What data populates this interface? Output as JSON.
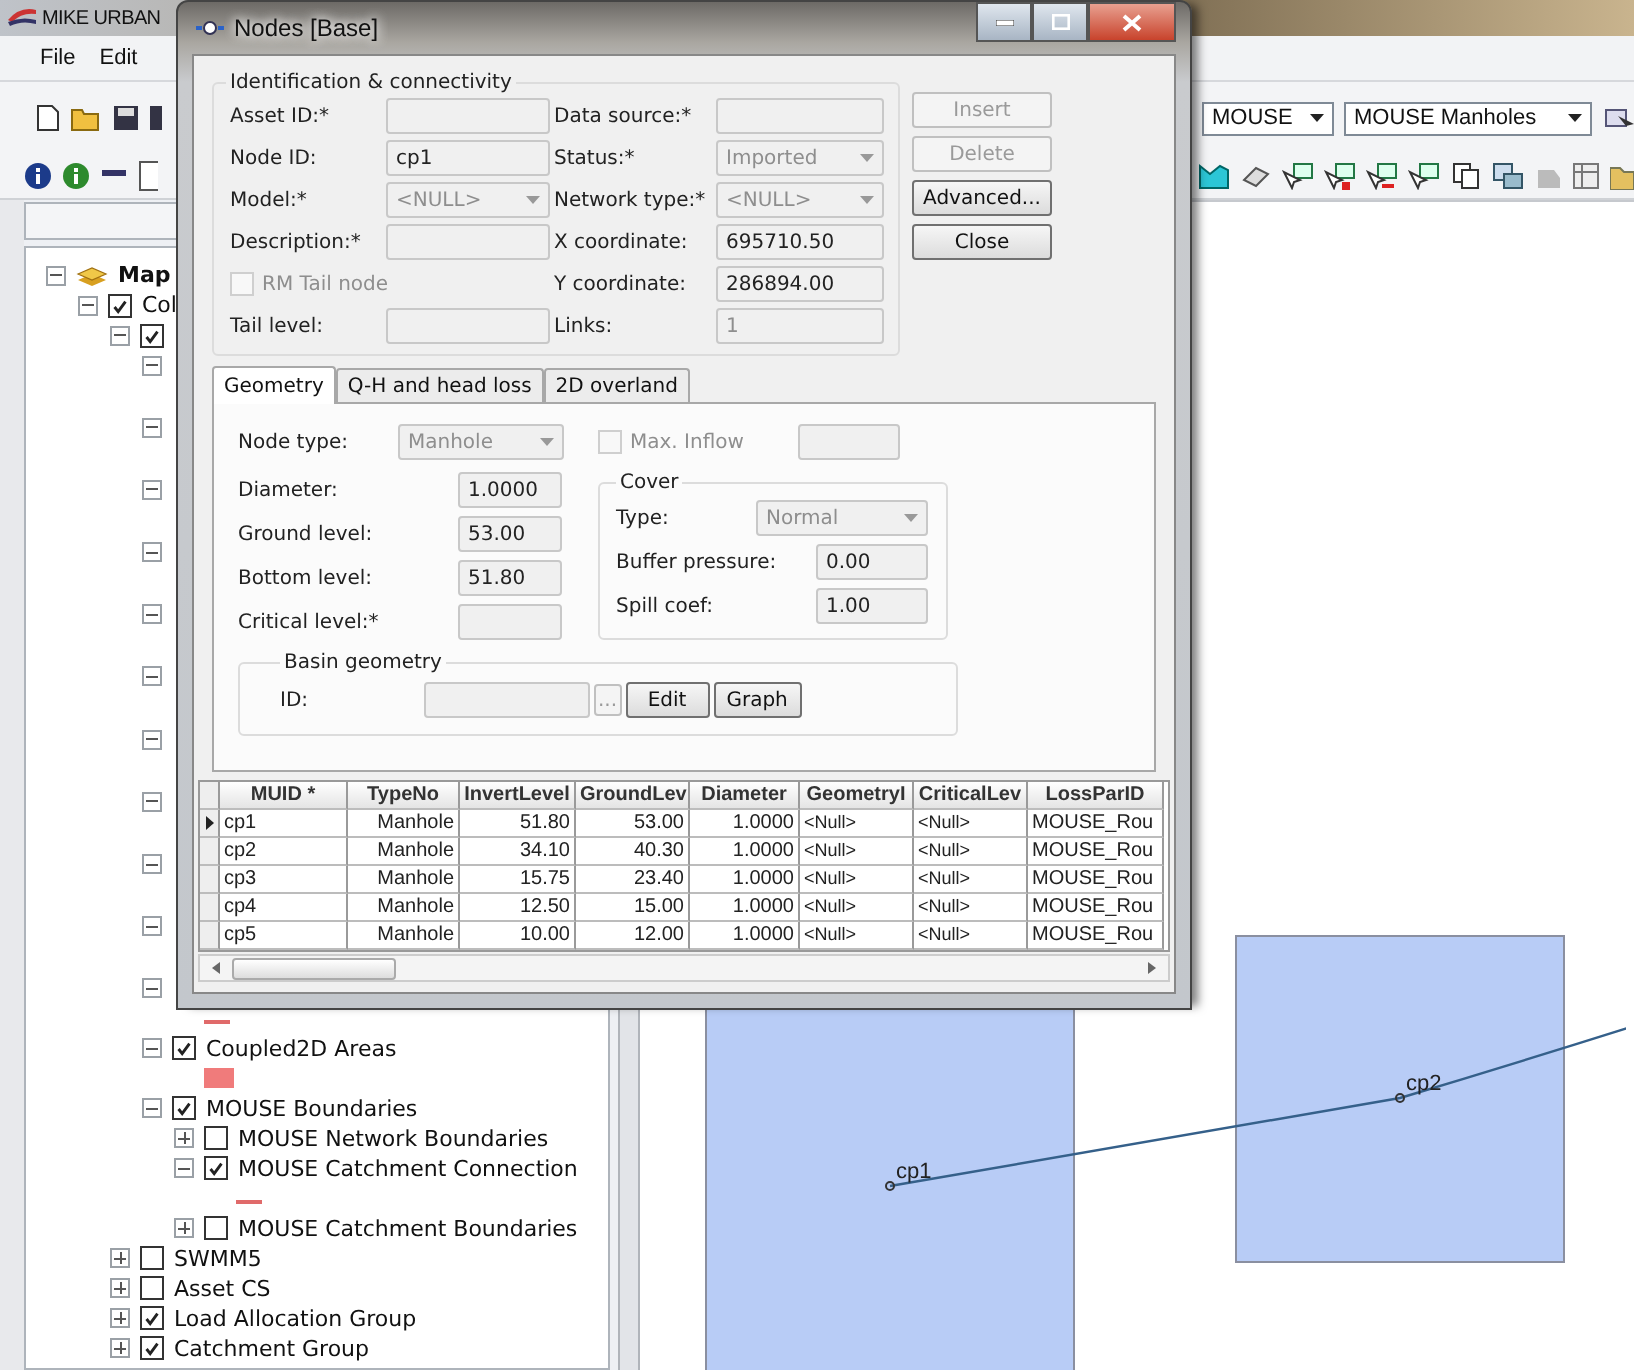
{
  "main_window": {
    "title": "MIKE URBAN",
    "menu": [
      "File",
      "Edit"
    ],
    "toolbar_dropdowns": [
      {
        "value": "MOUSE"
      },
      {
        "value": "MOUSE Manholes"
      }
    ]
  },
  "layers": [
    {
      "label": "Map",
      "expanded": true,
      "children": [
        {
          "label": "Col",
          "checked": true,
          "expanded": true,
          "children": [
            {
              "checked": true,
              "expanded": true,
              "children": [
                {
                  "expanded": true
                },
                {
                  "expanded": true
                },
                {
                  "expanded": true
                },
                {
                  "expanded": true
                },
                {
                  "expanded": true
                },
                {
                  "expanded": true
                },
                {
                  "expanded": true
                },
                {
                  "expanded": true
                },
                {
                  "expanded": true
                },
                {
                  "expanded": true
                },
                {
                  "expanded": true,
                  "legend": {
                    "kind": "line",
                    "color": "#e06a6a"
                  }
                },
                {
                  "label": "Coupled2D Areas",
                  "checked": true,
                  "expanded": true,
                  "legend": {
                    "kind": "fill",
                    "color": "#f07b7b"
                  }
                },
                {
                  "label": "MOUSE Boundaries",
                  "checked": true,
                  "expanded": true,
                  "children": [
                    {
                      "label": "MOUSE Network Boundaries",
                      "checked": false,
                      "expanded": false
                    },
                    {
                      "label": "MOUSE Catchment Connection",
                      "checked": true,
                      "expanded": true,
                      "legend": {
                        "kind": "line",
                        "color": "#e06a6a"
                      }
                    },
                    {
                      "label": "MOUSE Catchment Boundaries",
                      "checked": false,
                      "expanded": false
                    }
                  ]
                }
              ]
            },
            {
              "label": "SWMM5",
              "checked": false,
              "expanded": false
            },
            {
              "label": "Asset CS",
              "checked": false,
              "expanded": false
            },
            {
              "label": "Load Allocation Group",
              "checked": true,
              "expanded": false
            },
            {
              "label": "Catchment Group",
              "checked": true,
              "expanded": false
            }
          ]
        }
      ]
    }
  ],
  "map": {
    "nodes": [
      {
        "label": "cp1"
      },
      {
        "label": "cp2"
      }
    ]
  },
  "dialog": {
    "title": "Nodes [Base]",
    "identification": {
      "title": "Identification & connectivity",
      "fields": [
        {
          "label": "Asset ID:*",
          "kind": "text"
        },
        {
          "label": "Data source:*",
          "kind": "text"
        },
        {
          "label": "Node ID:",
          "kind": "text",
          "value": "cp1"
        },
        {
          "label": "Status:*",
          "kind": "dropdown",
          "value": "Imported",
          "disabled": true
        },
        {
          "label": "Model:*",
          "kind": "dropdown",
          "value": "<NULL>",
          "disabled": true
        },
        {
          "label": "Network type:*",
          "kind": "dropdown",
          "value": "<NULL>",
          "disabled": true
        },
        {
          "label": "Description:*",
          "kind": "text"
        },
        {
          "label": "X coordinate:",
          "kind": "text",
          "value": "695710.50"
        },
        {
          "label": "RM Tail node",
          "kind": "checkbox",
          "checked": false,
          "disabled": true
        },
        {
          "label": "Y coordinate:",
          "kind": "text",
          "value": "286894.00"
        },
        {
          "label": "Tail level:",
          "kind": "text"
        },
        {
          "label": "Links:",
          "kind": "text",
          "value": "1",
          "disabled": true
        }
      ]
    },
    "buttons": [
      {
        "label": "Insert",
        "disabled": true
      },
      {
        "label": "Delete",
        "disabled": true
      },
      {
        "label": "Advanced...",
        "disabled": false
      },
      {
        "label": "Close",
        "disabled": false
      }
    ],
    "tabs": [
      {
        "label": "Geometry",
        "selected": true
      },
      {
        "label": "Q-H and head loss",
        "selected": false
      },
      {
        "label": "2D overland",
        "selected": false
      }
    ],
    "geometry": {
      "node_type": {
        "label": "Node type:",
        "value": "Manhole",
        "disabled": true
      },
      "max_inflow": {
        "label": "Max. Inflow",
        "checked": false,
        "disabled": true
      },
      "fields": [
        {
          "label": "Diameter:",
          "value": "1.0000"
        },
        {
          "label": "Ground level:",
          "value": "53.00"
        },
        {
          "label": "Bottom level:",
          "value": "51.80"
        },
        {
          "label": "Critical level:*"
        }
      ],
      "cover": {
        "title": "Cover",
        "type": {
          "label": "Type:",
          "value": "Normal",
          "disabled": true
        },
        "fields": [
          {
            "label": "Buffer pressure:",
            "value": "0.00"
          },
          {
            "label": "Spill coef:",
            "value": "1.00"
          }
        ]
      },
      "basin": {
        "title": "Basin geometry",
        "id_label": "ID:",
        "buttons": [
          "...",
          "Edit",
          "Graph"
        ]
      }
    },
    "table": {
      "columns": [
        "MUID *",
        "TypeNo",
        "InvertLevel",
        "GroundLev",
        "Diameter",
        "GeometryI",
        "CriticalLev",
        "LossParID"
      ],
      "rows": [
        {
          "selected": true,
          "cells": [
            "cp1",
            "Manhole",
            "51.80",
            "53.00",
            "1.0000",
            "<Null>",
            "<Null>",
            "MOUSE_Rou"
          ]
        },
        {
          "selected": false,
          "cells": [
            "cp2",
            "Manhole",
            "34.10",
            "40.30",
            "1.0000",
            "<Null>",
            "<Null>",
            "MOUSE_Rou"
          ]
        },
        {
          "selected": false,
          "cells": [
            "cp3",
            "Manhole",
            "15.75",
            "23.40",
            "1.0000",
            "<Null>",
            "<Null>",
            "MOUSE_Rou"
          ]
        },
        {
          "selected": false,
          "cells": [
            "cp4",
            "Manhole",
            "12.50",
            "15.00",
            "1.0000",
            "<Null>",
            "<Null>",
            "MOUSE_Rou"
          ]
        },
        {
          "selected": false,
          "cells": [
            "cp5",
            "Manhole",
            "10.00",
            "12.00",
            "1.0000",
            "<Null>",
            "<Null>",
            "MOUSE_Rou"
          ]
        }
      ]
    }
  }
}
